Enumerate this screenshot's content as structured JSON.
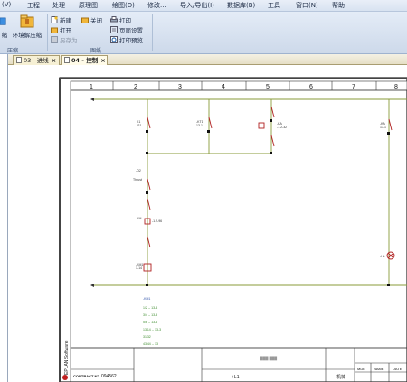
{
  "menubar": {
    "items": [
      {
        "label": "(V)"
      },
      {
        "label": "工程"
      },
      {
        "label": "处理"
      },
      {
        "label": "原理图"
      },
      {
        "label": "绘图(D)"
      },
      {
        "label": "修改..."
      },
      {
        "label": "导入/导出(I)"
      },
      {
        "label": "数据库(B)"
      },
      {
        "label": "工具"
      },
      {
        "label": "窗口(N)"
      },
      {
        "label": "帮助"
      }
    ]
  },
  "ribbon": {
    "compress_group": {
      "compress_label": "缩",
      "env_compress_label": "环境解压缩",
      "group_label": "压缩"
    },
    "drawing_group": {
      "new_label": "新建",
      "open_label": "打开",
      "save_as_label": "另存为",
      "close_label": "关闭",
      "print_label": "打印",
      "page_setup_label": "页面设置",
      "print_preview_label": "打印预览",
      "group_label": "图纸"
    }
  },
  "tabs": [
    {
      "label": "03 - 进线",
      "close": "×"
    },
    {
      "label": "04 - 控制",
      "close": "×"
    }
  ],
  "sheet": {
    "columns": [
      "1",
      "2",
      "3",
      "4",
      "5",
      "6",
      "7",
      "8"
    ],
    "component_labels": {
      "k1_upper": "K1",
      "k1_upper_sub": "-S1",
      "kt1": "-KT1",
      "kt1_sub": "13-1",
      "ka": "-KA",
      "ka_sub": "-1.2-32",
      "ka2": "-KA",
      "ka2_sub": "13-1",
      "q2": "-Q2",
      "q2_sub": "Thrust",
      "km1_upper": "-KM",
      "km1_lower": "-1.2-96",
      "hl": "-HL",
      "km": "-KM1",
      "km_sub": "1-14"
    },
    "contact_table": {
      "title": "-KM1",
      "rows": [
        "1/2 -- 13-4",
        "3/4 -- 13-5",
        "5/6 -- 13-6",
        "13/14 -- 13-3",
        "31/32",
        "43/44 -- 13"
      ]
    },
    "titleblock": {
      "brand": "EPLAN Software",
      "contract_label": "CONTRACT N°:",
      "contract_number": "094562",
      "level": "+L1",
      "location": "机械",
      "rev_headers": [
        "MDE",
        "NAME",
        "DATE"
      ],
      "blurred_company": "███ ███"
    }
  },
  "colors": {
    "ribbon_bg": "#d8e3f1",
    "wire": "#8a9b3a",
    "component": "#b02020",
    "tab_active": "#fffbe8"
  }
}
